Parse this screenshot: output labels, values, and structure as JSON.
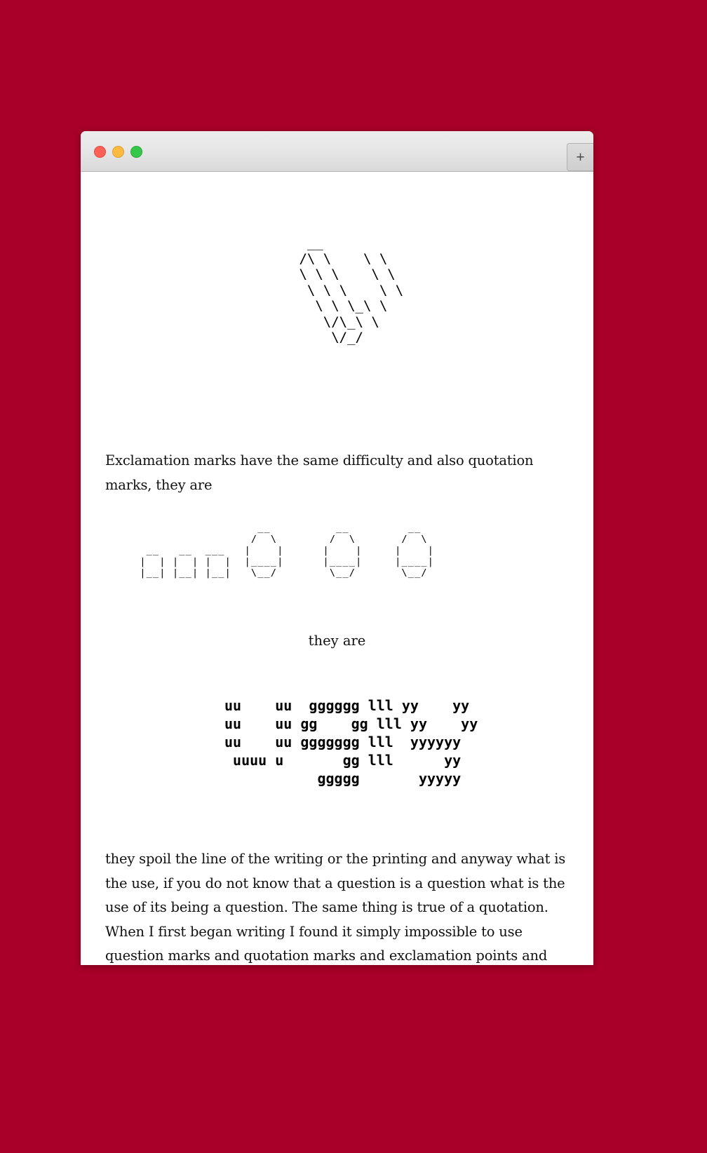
{
  "window": {
    "traffic_lights": [
      {
        "name": "close",
        "color": "#fc6158"
      },
      {
        "name": "minimize",
        "color": "#fcbb40"
      },
      {
        "name": "maximize",
        "color": "#34c749"
      }
    ],
    "new_tab_label": "+"
  },
  "background_color": "#a80028",
  "page": {
    "ascii_exclamation": "  __\n /\\ \\    \\ \\\n \\ \\ \\    \\ \\\n  \\ \\ \\    \\ \\\n   \\ \\ \\_\\ \\\n    \\/\\_\\ \\\n     \\/_/",
    "paragraph_lead": "Exclamation marks have the same difficulty and also quotation marks, they are",
    "ascii_unnecessary": "                   __          __         __\n                  /  \\        /  \\       /  \\\n  __   __  ___   |    |      |    |     |    |\n |  | |  | |  |  |____|      |____|     |____|\n |__| |__| |__|   \\__/        \\__/       \\__/",
    "they_are_label": "they are",
    "ascii_ugly_lines": [
      "uu    uu  gggggg lll yy    yy",
      "uu    uu gg    gg lll yy    yy",
      "uu    uu ggggggg lll  yyyyyy",
      " uuuu u       gg lll      yy",
      "           ggggg       yyyyy"
    ],
    "paragraph_tail": "they spoil the line of the writing or the printing and anyway what is the use, if you do not know that a question is a question what is the use of its being a question. The same thing is true of a quotation. When I first began writing I found it simply impossible to use question marks and quotation marks and exclamation points and now anybody sees it that way. Perhaps some day they will see it some"
  }
}
